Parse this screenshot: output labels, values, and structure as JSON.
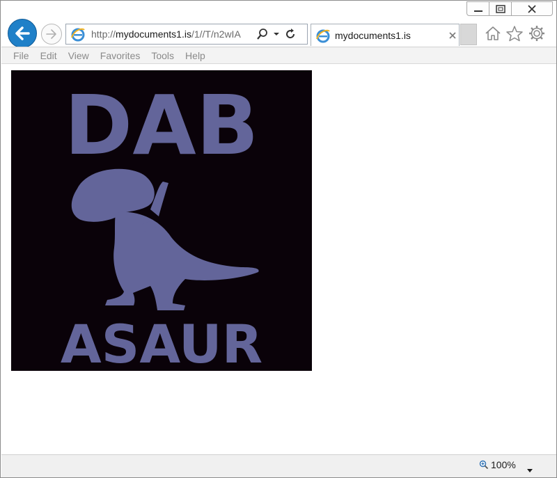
{
  "browser": {
    "address": {
      "url_prefix": "http://",
      "url_host": "mydocuments1.is",
      "url_path": "/1//T/n2wIA"
    },
    "tab": {
      "title": "mydocuments1.is"
    },
    "menu": [
      "File",
      "Edit",
      "View",
      "Favorites",
      "Tools",
      "Help"
    ],
    "status": {
      "zoom": "100%"
    }
  },
  "page": {
    "image": {
      "line1": "DAB",
      "line2": "ASAUR",
      "colors": {
        "background": "#0a0209",
        "artwork": "#63659a"
      }
    }
  },
  "icons": {
    "back": "back-arrow-icon",
    "forward": "forward-arrow-icon",
    "address_ie": "ie-logo-icon",
    "search": "search-icon",
    "dropdown": "chevron-down-icon",
    "refresh": "refresh-icon",
    "tab_close": "close-icon",
    "home": "home-icon",
    "favorites": "star-icon",
    "tools": "gear-icon",
    "zoom": "zoom-icon"
  }
}
